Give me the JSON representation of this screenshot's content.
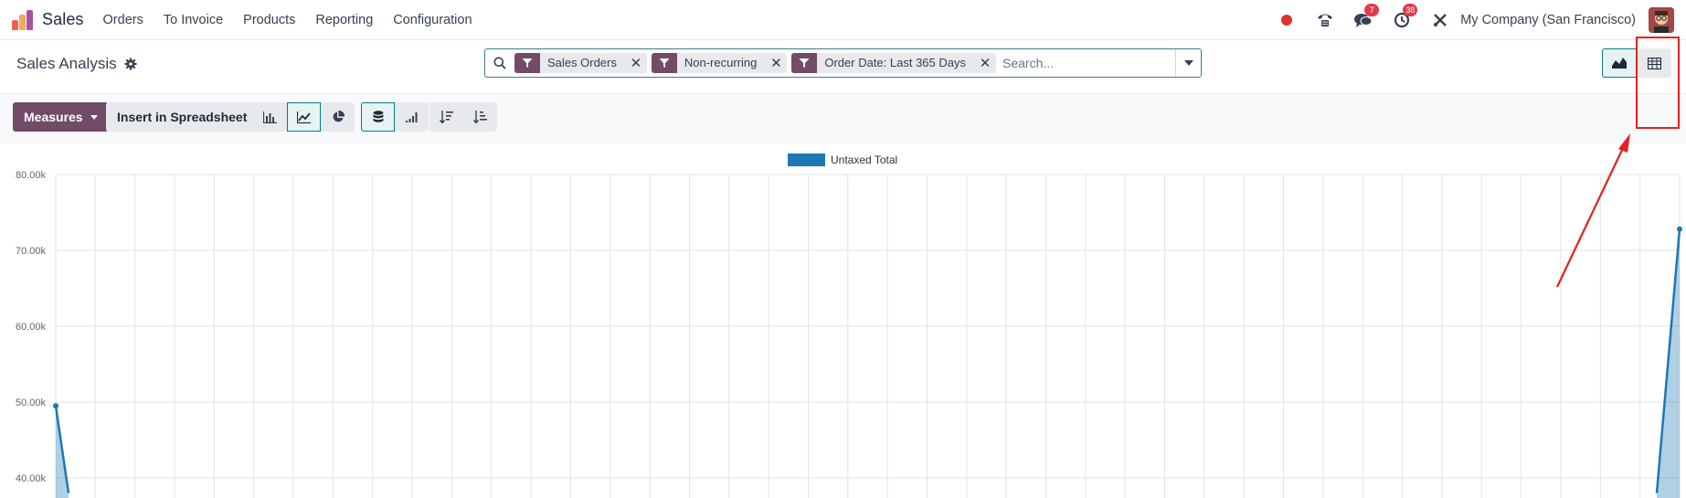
{
  "navbar": {
    "app_name": "Sales",
    "menu": [
      "Orders",
      "To Invoice",
      "Products",
      "Reporting",
      "Configuration"
    ],
    "messages_count": "7",
    "activities_count": "38",
    "company": "My Company (San Francisco)"
  },
  "control_panel": {
    "title": "Sales Analysis",
    "facets": [
      {
        "label": "Sales Orders"
      },
      {
        "label": "Non-recurring"
      },
      {
        "label": "Order Date: Last 365 Days"
      }
    ],
    "search_placeholder": "Search...",
    "measures_label": "Measures",
    "insert_label": "Insert in Spreadsheet"
  },
  "colors": {
    "brand": "#714b67",
    "accent": "#017e84",
    "series": "#1f77b4",
    "annotation": "#e61f1f"
  },
  "chart_data": {
    "type": "area",
    "legend": [
      "Untaxed Total"
    ],
    "series": [
      {
        "name": "Untaxed Total",
        "values": [
          49500,
          38000,
          null,
          38000,
          72800
        ]
      }
    ],
    "y_ticks": [
      "80.00k",
      "70.00k",
      "60.00k",
      "50.00k",
      "40.00k"
    ],
    "ylim": [
      36000,
      80000
    ],
    "grid": true,
    "legend_position": "top-center"
  }
}
